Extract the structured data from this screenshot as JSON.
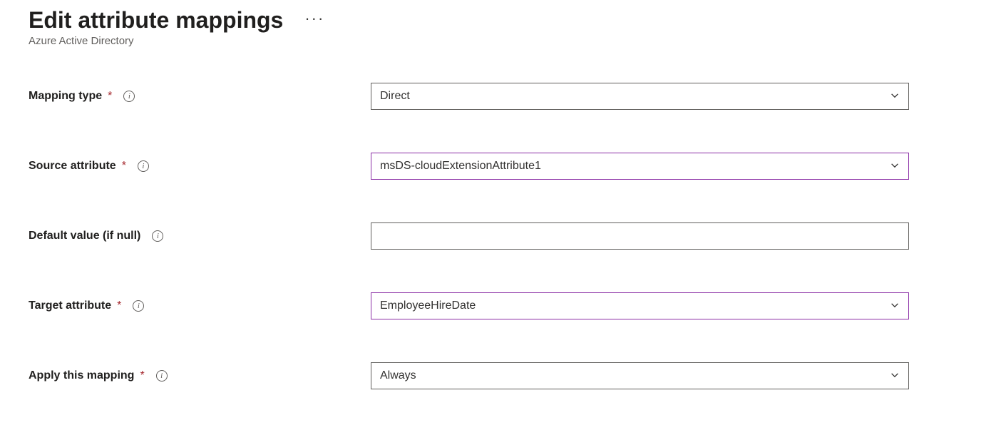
{
  "header": {
    "title": "Edit attribute mappings",
    "breadcrumb": "Azure Active Directory"
  },
  "form": {
    "mapping_type": {
      "label": "Mapping type",
      "value": "Direct"
    },
    "source_attribute": {
      "label": "Source attribute",
      "value": "msDS-cloudExtensionAttribute1"
    },
    "default_value": {
      "label": "Default value (if null)",
      "value": ""
    },
    "target_attribute": {
      "label": "Target attribute",
      "value": "EmployeeHireDate"
    },
    "apply_mapping": {
      "label": "Apply this mapping",
      "value": "Always"
    }
  }
}
